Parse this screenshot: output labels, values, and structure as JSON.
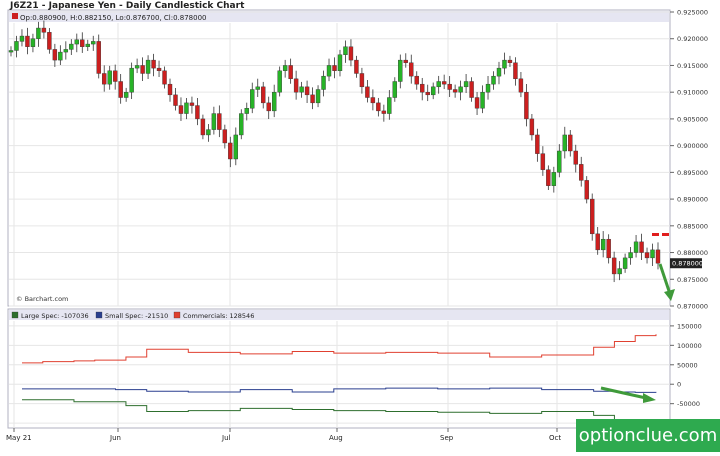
{
  "header": {
    "title": "J6Z21 - Japanese Yen - Daily Candlestick Chart",
    "ohlc_text": "Op:0.880900, H:0.882150, Lo:0.876700, Cl:0.878000",
    "credit": "© Barchart.com"
  },
  "price_axis": {
    "ticks": [
      "0.925000",
      "0.920000",
      "0.915000",
      "0.910000",
      "0.905000",
      "0.900000",
      "0.895000",
      "0.890000",
      "0.885000",
      "0.880000",
      "0.875000",
      "0.870000"
    ],
    "last_label": "0.878000"
  },
  "cot_axis": {
    "ticks": [
      "150000",
      "100000",
      "50000",
      "0",
      "-50000",
      "-100000"
    ]
  },
  "x_axis": {
    "labels": [
      "May 21",
      "Jun",
      "Jul",
      "Aug",
      "Sep",
      "Oct"
    ]
  },
  "legend": [
    {
      "label": "Large Spec: -107036",
      "color": "#2e6f2e"
    },
    {
      "label": "Small Spec: -21510",
      "color": "#2a3f8f"
    },
    {
      "label": "Commercials: 128546",
      "color": "#e04030"
    }
  ],
  "watermark": "optionclue.com",
  "colors": {
    "up": "#27b327",
    "down": "#cc1f1f",
    "large_spec": "#2e6f2e",
    "small_spec": "#2a3f8f",
    "commercials": "#e04030",
    "arrow": "#3f9a3a",
    "resistance": "#e01e1e"
  },
  "chart_data": [
    {
      "type": "candlestick",
      "title": "J6Z21 - Japanese Yen - Daily Candlestick Chart",
      "ylim": [
        0.87,
        0.925
      ],
      "x_labels": [
        "May 21",
        "Jun",
        "Jul",
        "Aug",
        "Sep",
        "Oct"
      ],
      "last_close": 0.878,
      "closes": [
        0.9178,
        0.9195,
        0.9205,
        0.9185,
        0.92,
        0.922,
        0.9212,
        0.918,
        0.916,
        0.9175,
        0.918,
        0.919,
        0.9198,
        0.9185,
        0.919,
        0.9195,
        0.9135,
        0.9115,
        0.914,
        0.912,
        0.909,
        0.91,
        0.9145,
        0.915,
        0.9135,
        0.916,
        0.9145,
        0.914,
        0.9115,
        0.9095,
        0.9075,
        0.906,
        0.908,
        0.9075,
        0.905,
        0.902,
        0.903,
        0.906,
        0.903,
        0.9005,
        0.8975,
        0.902,
        0.906,
        0.907,
        0.9105,
        0.911,
        0.908,
        0.9065,
        0.91,
        0.914,
        0.915,
        0.9125,
        0.91,
        0.911,
        0.9095,
        0.908,
        0.9105,
        0.913,
        0.915,
        0.914,
        0.917,
        0.9185,
        0.916,
        0.9135,
        0.911,
        0.909,
        0.908,
        0.9065,
        0.906,
        0.909,
        0.912,
        0.916,
        0.9155,
        0.913,
        0.9115,
        0.91,
        0.9095,
        0.911,
        0.912,
        0.9115,
        0.9105,
        0.91,
        0.911,
        0.912,
        0.909,
        0.907,
        0.91,
        0.9115,
        0.913,
        0.9145,
        0.916,
        0.9155,
        0.9125,
        0.91,
        0.905,
        0.902,
        0.8985,
        0.8955,
        0.8925,
        0.895,
        0.899,
        0.902,
        0.899,
        0.8965,
        0.8935,
        0.89,
        0.8835,
        0.8805,
        0.8825,
        0.879,
        0.876,
        0.877,
        0.879,
        0.88,
        0.882,
        0.88,
        0.879,
        0.8805,
        0.878
      ],
      "series": [
        {
          "name": "Large Spec",
          "last": -107036,
          "values": [
            -40000,
            -40000,
            -40000,
            -40000,
            -40000,
            -45000,
            -45000,
            -45000,
            -45000,
            -45000,
            -55000,
            -55000,
            -70000,
            -70000,
            -70000,
            -70000,
            -68000,
            -68000,
            -68000,
            -68000,
            -68000,
            -62000,
            -62000,
            -62000,
            -62000,
            -62000,
            -65000,
            -65000,
            -65000,
            -65000,
            -68000,
            -68000,
            -68000,
            -68000,
            -68000,
            -70000,
            -70000,
            -70000,
            -70000,
            -70000,
            -72000,
            -72000,
            -72000,
            -72000,
            -72000,
            -75000,
            -75000,
            -75000,
            -75000,
            -75000,
            -70000,
            -70000,
            -70000,
            -70000,
            -70000,
            -80000,
            -80000,
            -95000,
            -95000,
            -105000,
            -105000,
            -107036
          ]
        },
        {
          "name": "Small Spec",
          "last": -21510,
          "values": [
            -12000,
            -12000,
            -12000,
            -12000,
            -12000,
            -12000,
            -12000,
            -12000,
            -12000,
            -14000,
            -14000,
            -14000,
            -18000,
            -18000,
            -18000,
            -18000,
            -20000,
            -20000,
            -20000,
            -20000,
            -20000,
            -14000,
            -14000,
            -14000,
            -14000,
            -14000,
            -20000,
            -20000,
            -20000,
            -20000,
            -12000,
            -12000,
            -12000,
            -12000,
            -12000,
            -10000,
            -10000,
            -10000,
            -10000,
            -10000,
            -12000,
            -12000,
            -12000,
            -12000,
            -12000,
            -10000,
            -10000,
            -10000,
            -10000,
            -10000,
            -14000,
            -14000,
            -14000,
            -14000,
            -14000,
            -18000,
            -18000,
            -20000,
            -20000,
            -21000,
            -21000,
            -21510
          ]
        },
        {
          "name": "Commercials",
          "last": 128546,
          "values": [
            55000,
            55000,
            58000,
            58000,
            58000,
            60000,
            60000,
            62000,
            62000,
            62000,
            70000,
            70000,
            90000,
            90000,
            90000,
            90000,
            82000,
            82000,
            82000,
            82000,
            82000,
            78000,
            78000,
            78000,
            78000,
            78000,
            84000,
            84000,
            84000,
            84000,
            80000,
            80000,
            80000,
            80000,
            80000,
            82000,
            82000,
            82000,
            82000,
            82000,
            80000,
            80000,
            80000,
            80000,
            80000,
            70000,
            70000,
            70000,
            70000,
            70000,
            75000,
            75000,
            75000,
            75000,
            75000,
            95000,
            95000,
            110000,
            110000,
            125000,
            125000,
            128546
          ]
        }
      ],
      "cot_ylim": [
        -110000,
        160000
      ]
    }
  ]
}
